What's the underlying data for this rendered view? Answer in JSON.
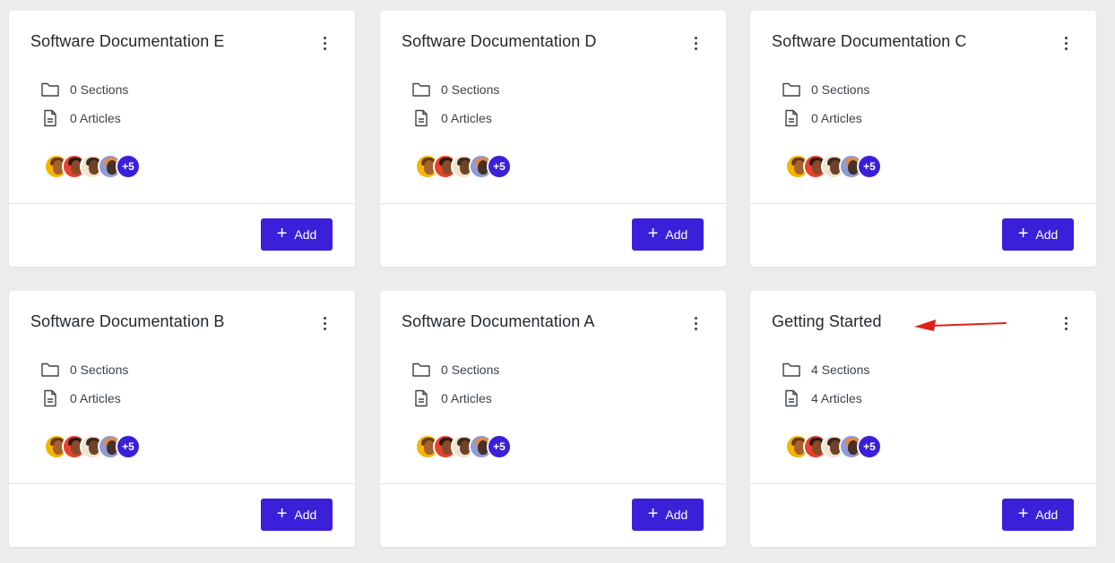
{
  "cards": [
    {
      "title": "Software Documentation E",
      "sections": "0 Sections",
      "articles": "0 Articles",
      "more_count": "+5",
      "add_label": "Add"
    },
    {
      "title": "Software Documentation D",
      "sections": "0 Sections",
      "articles": "0 Articles",
      "more_count": "+5",
      "add_label": "Add"
    },
    {
      "title": "Software Documentation C",
      "sections": "0 Sections",
      "articles": "0 Articles",
      "more_count": "+5",
      "add_label": "Add"
    },
    {
      "title": "Software Documentation B",
      "sections": "0 Sections",
      "articles": "0 Articles",
      "more_count": "+5",
      "add_label": "Add"
    },
    {
      "title": "Software Documentation A",
      "sections": "0 Sections",
      "articles": "0 Articles",
      "more_count": "+5",
      "add_label": "Add"
    },
    {
      "title": "Getting Started",
      "sections": "4 Sections",
      "articles": "4 Articles",
      "more_count": "+5",
      "add_label": "Add"
    }
  ],
  "icons": {
    "sections": "folder-icon",
    "articles": "document-icon",
    "menu": "more-vertical-icon",
    "add": "plus-icon"
  },
  "colors": {
    "accent": "#3a20d8",
    "annotation_arrow": "#e0201b",
    "background": "#ececec"
  }
}
